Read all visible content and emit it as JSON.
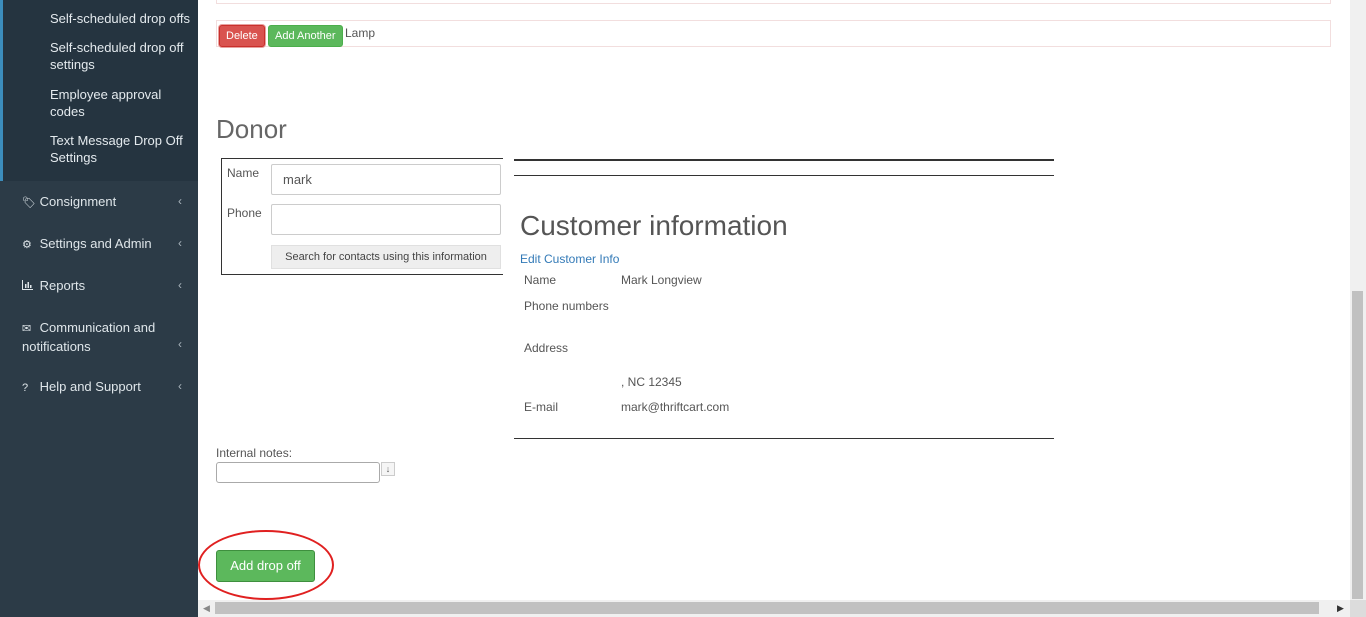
{
  "sidebar": {
    "sub_items": [
      "Self-scheduled drop offs",
      "Self-scheduled drop off settings",
      "Employee approval codes",
      "Text Message Drop Off Settings"
    ],
    "nav_items": [
      {
        "label": "Consignment",
        "icon": "tags-icon"
      },
      {
        "label": "Settings and Admin",
        "icon": "gear-icon"
      },
      {
        "label": "Reports",
        "icon": "bar-chart-icon"
      },
      {
        "label": "Communication and notifications",
        "icon": "envelope-icon"
      },
      {
        "label": "Help and Support",
        "icon": "question-circle-icon"
      }
    ],
    "chevron": "‹"
  },
  "items": {
    "delete_label": "Delete",
    "add_another_label": "Add Another",
    "item_name": "Lamp"
  },
  "donor": {
    "title": "Donor",
    "name_label": "Name",
    "name_value": "mark",
    "phone_label": "Phone",
    "phone_value": "",
    "search_button_label": "Search for contacts using this information"
  },
  "customer": {
    "title": "Customer information",
    "edit_link": "Edit Customer Info",
    "name_label": "Name",
    "name_value": "Mark Longview",
    "phone_label": "Phone numbers",
    "phone_value": "",
    "address_label": "Address",
    "address_value": ", NC 12345",
    "email_label": "E-mail",
    "email_value": "mark@thriftcart.com"
  },
  "notes": {
    "label": "Internal notes:",
    "value": "",
    "expand_icon": "↓"
  },
  "actions": {
    "add_drop_off_label": "Add drop off"
  },
  "colors": {
    "sidebar_bg": "#2c3b47",
    "delete": "#d9534f",
    "success": "#5cb85c",
    "link": "#337ab7",
    "highlight": "#e02020"
  }
}
